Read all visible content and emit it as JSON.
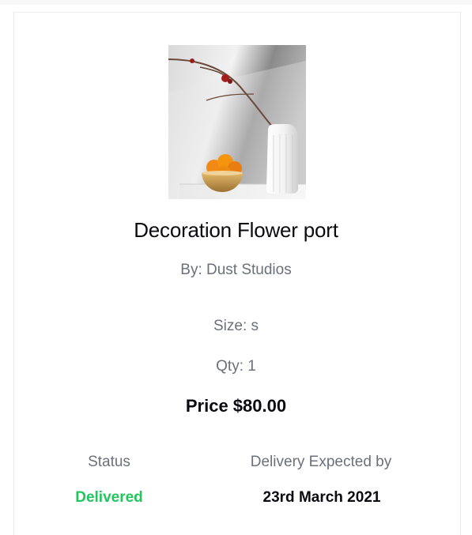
{
  "product": {
    "title": "Decoration Flower port",
    "brand": "By: Dust Studios",
    "size": "Size: s",
    "qty": "Qty: 1",
    "price": "Price $80.00"
  },
  "order": {
    "status_label": "Status",
    "status_value": "Delivered",
    "delivery_label": "Delivery Expected by",
    "delivery_value": "23rd March 2021"
  },
  "colors": {
    "status_delivered": "#22c55e",
    "muted_text": "#6b7079",
    "primary_text": "#0b0b0f"
  },
  "icons": {
    "product_image": "vase-with-oranges-photo"
  }
}
